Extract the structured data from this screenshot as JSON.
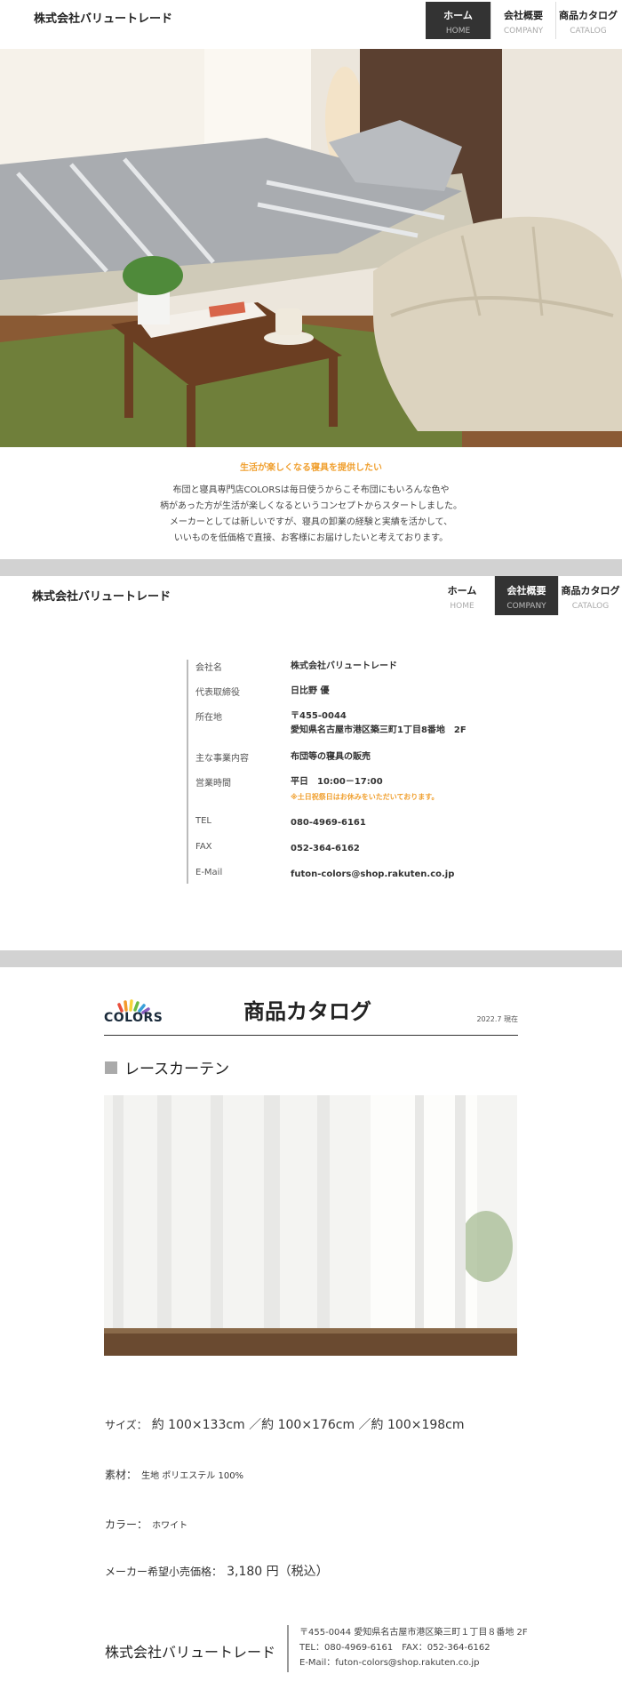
{
  "company_name": "株式会社バリュートレード",
  "nav": [
    {
      "jp": "ホーム",
      "en": "HOME"
    },
    {
      "jp": "会社概要",
      "en": "COMPANY"
    },
    {
      "jp": "商品カタログ",
      "en": "CATALOG"
    }
  ],
  "hero": {
    "tagline": "生活が楽しくなる寝具を提供したい",
    "intro": [
      "布団と寝具専門店COLORSは毎日使うからこそ布団にもいろんな色や",
      "柄があった方が生活が楽しくなるというコンセプトからスタートしました。",
      "メーカーとしては新しいですが、寝具の卸業の経験と実績を活かして、",
      "いいものを低価格で直接、お客様にお届けしたいと考えております。"
    ]
  },
  "company": {
    "rows": [
      {
        "label": "会社名",
        "value": "株式会社バリュートレード"
      },
      {
        "label": "代表取締役",
        "value": "日比野 優"
      },
      {
        "label": "所在地",
        "value": "〒455-0044",
        "value2": "愛知県名古屋市港区築三町1丁目8番地　2F"
      },
      {
        "label": "主な事業内容",
        "value": "布団等の寝具の販売"
      },
      {
        "label": "営業時間",
        "value": "平日　10:00－17:00",
        "note": "※土日祝祭日はお休みをいただいております。"
      },
      {
        "label": "TEL",
        "value": "080-4969-6161"
      },
      {
        "label": "FAX",
        "value": "052-364-6162"
      },
      {
        "label": "E-Mail",
        "value": "futon-colors@shop.rakuten.co.jp"
      }
    ]
  },
  "catalog": {
    "logo_text": "COLORS",
    "title": "商品カタログ",
    "date": "2022.7 現在",
    "product_name": "レースカーテン",
    "size_label": "サイズ：",
    "size_value": "約 100×133cm ／約 100×176cm ／約 100×198cm",
    "material_label": "素材：",
    "material_value": "生地 ポリエステル 100%",
    "color_label": "カラー：",
    "color_value": "ホワイト",
    "price_label": "メーカー希望小売価格：",
    "price_value": "3,180 円（税込）"
  },
  "footer": {
    "name": "株式会社バリュートレード",
    "address": "〒455-0044 愛知県名古屋市港区築三町１丁目８番地 2F",
    "phone": "TEL：080-4969-6161　FAX：052-364-6162",
    "email": "E-Mail：futon-colors@shop.rakuten.co.jp"
  },
  "colors": {
    "accent": "#f0a030",
    "nav_active_bg": "#333333",
    "band": "#d2d2d2"
  }
}
